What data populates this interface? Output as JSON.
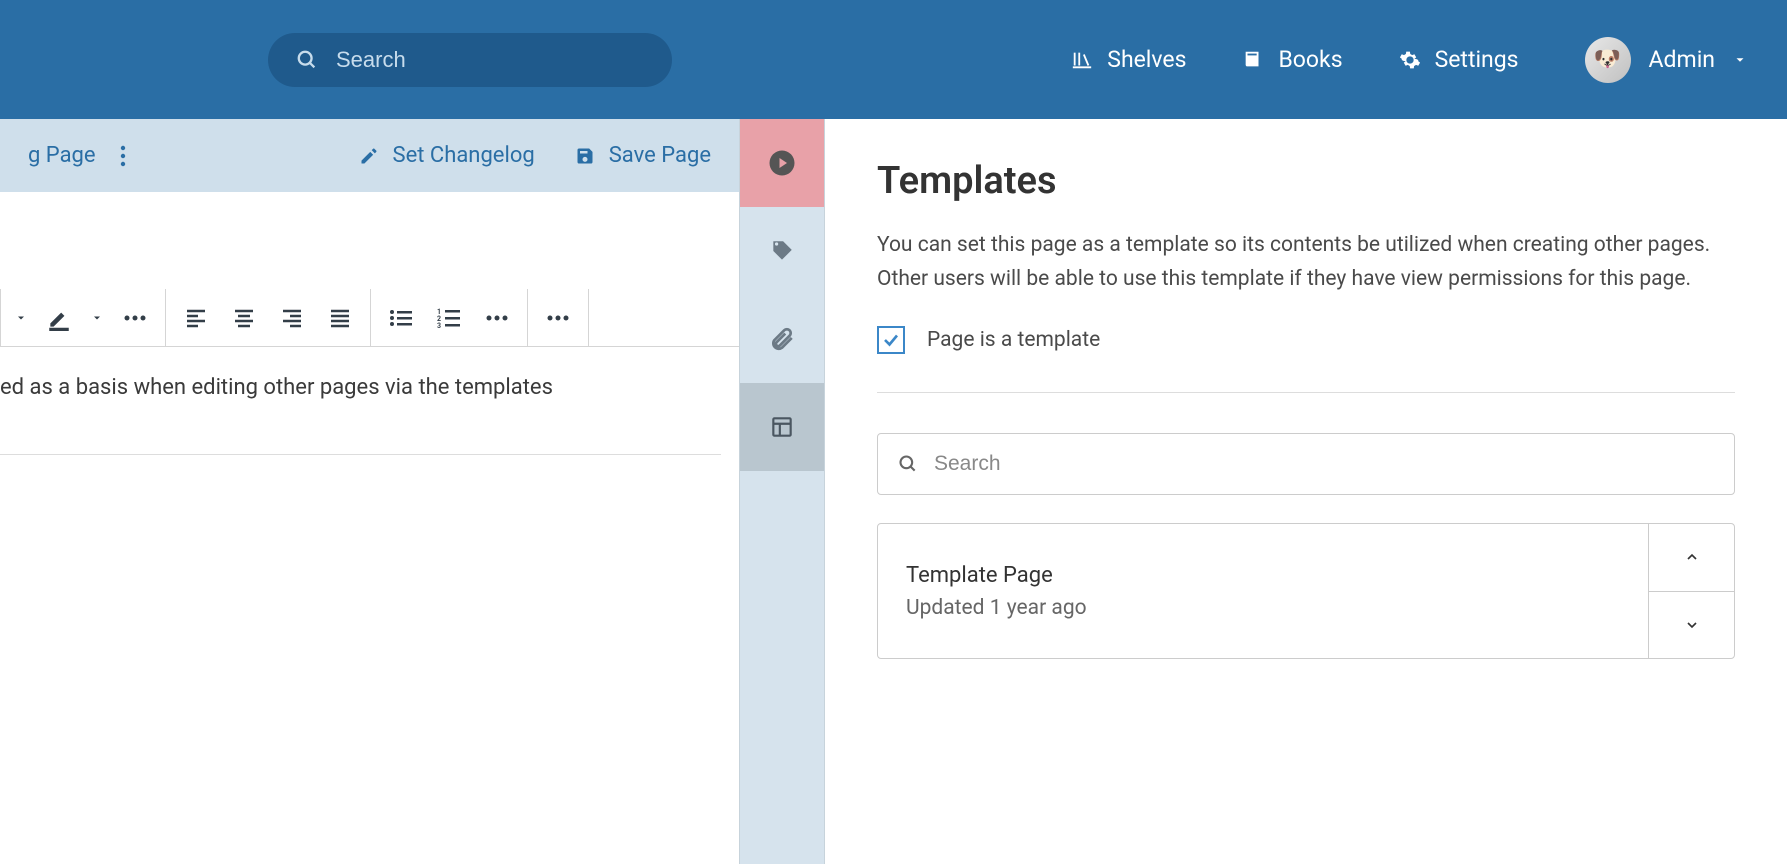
{
  "header": {
    "search_placeholder": "Search",
    "nav": {
      "shelves": "Shelves",
      "books": "Books",
      "settings": "Settings"
    },
    "user": "Admin"
  },
  "editor_bar": {
    "page_fragment": "g Page",
    "set_changelog": "Set Changelog",
    "save_page": "Save Page"
  },
  "editor_text": "ed as a basis when editing other pages via the templates",
  "templates_panel": {
    "title": "Templates",
    "description": "You can set this page as a template so its contents be utilized when creating other pages. Other users will be able to use this template if they have view permissions for this page.",
    "checkbox_label": "Page is a template",
    "checked": true,
    "search_placeholder": "Search",
    "items": [
      {
        "name": "Template Page",
        "updated": "Updated 1 year ago"
      }
    ]
  }
}
